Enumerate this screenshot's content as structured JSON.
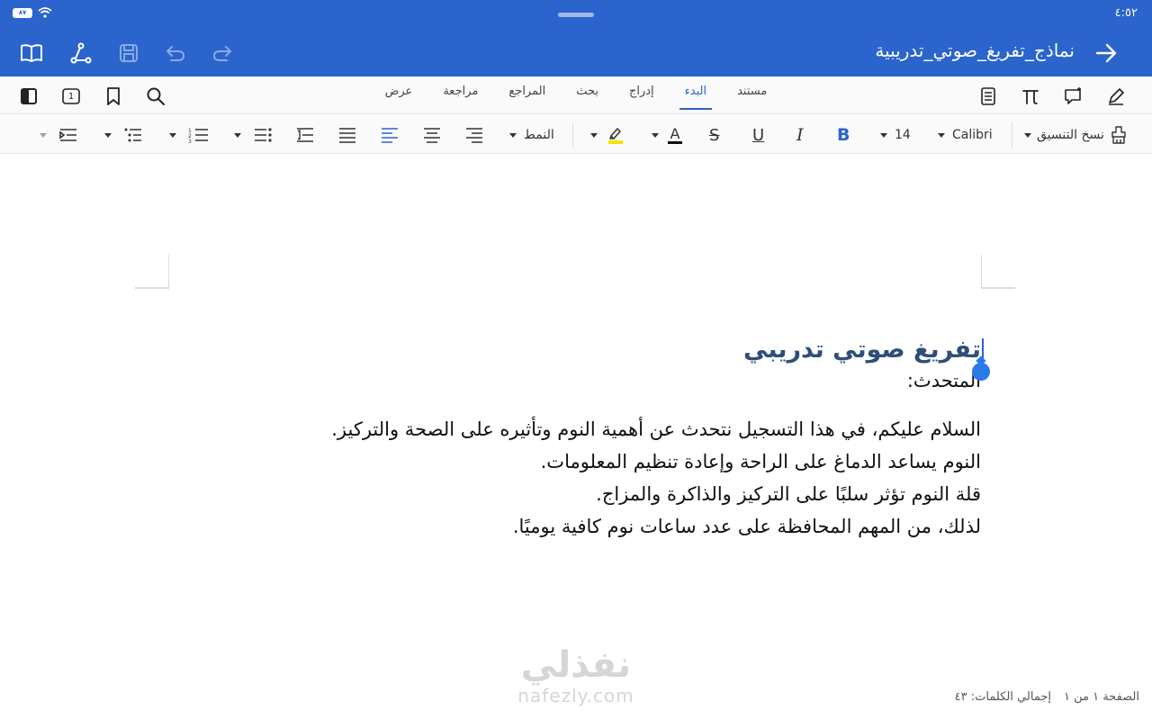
{
  "status": {
    "time": "٤:٥٢",
    "battery": "٨٧"
  },
  "header": {
    "title": "نماذج_تفريغ_صوتي_تدريبية"
  },
  "tabs": [
    "مستند",
    "البدء",
    "إدراج",
    "بحث",
    "المراجع",
    "مراجعة",
    "عرض"
  ],
  "active_tab": "البدء",
  "toolbar": {
    "font_size": "14",
    "font_name": "Calibri",
    "format_painter": "نسخ التنسيق",
    "style": "النمط",
    "page_badge": "1",
    "bold": "B",
    "italic": "I",
    "underline": "U",
    "strike": "S",
    "font_color": "A"
  },
  "document": {
    "heading": "تفريغ صوتي تدريبي",
    "speaker": "المتحدث:",
    "lines": [
      "السلام عليكم، في هذا التسجيل نتحدث عن أهمية النوم وتأثيره على الصحة والتركيز.",
      "النوم يساعد الدماغ على الراحة وإعادة تنظيم المعلومات.",
      "قلة النوم تؤثر سلبًا على التركيز والذاكرة والمزاج.",
      "لذلك، من المهم المحافظة على عدد ساعات نوم كافية يوميًا."
    ]
  },
  "watermark": {
    "arabic": "نفذلي",
    "latin": "nafezly.com"
  },
  "footer": {
    "page_info": "الصفحة ١ من ١",
    "word_count": "إجمالي الكلمات: ٤٣"
  },
  "colors": {
    "brand": "#2a64cc",
    "heading": "#2f4d78",
    "highlight": "#f5e400"
  }
}
